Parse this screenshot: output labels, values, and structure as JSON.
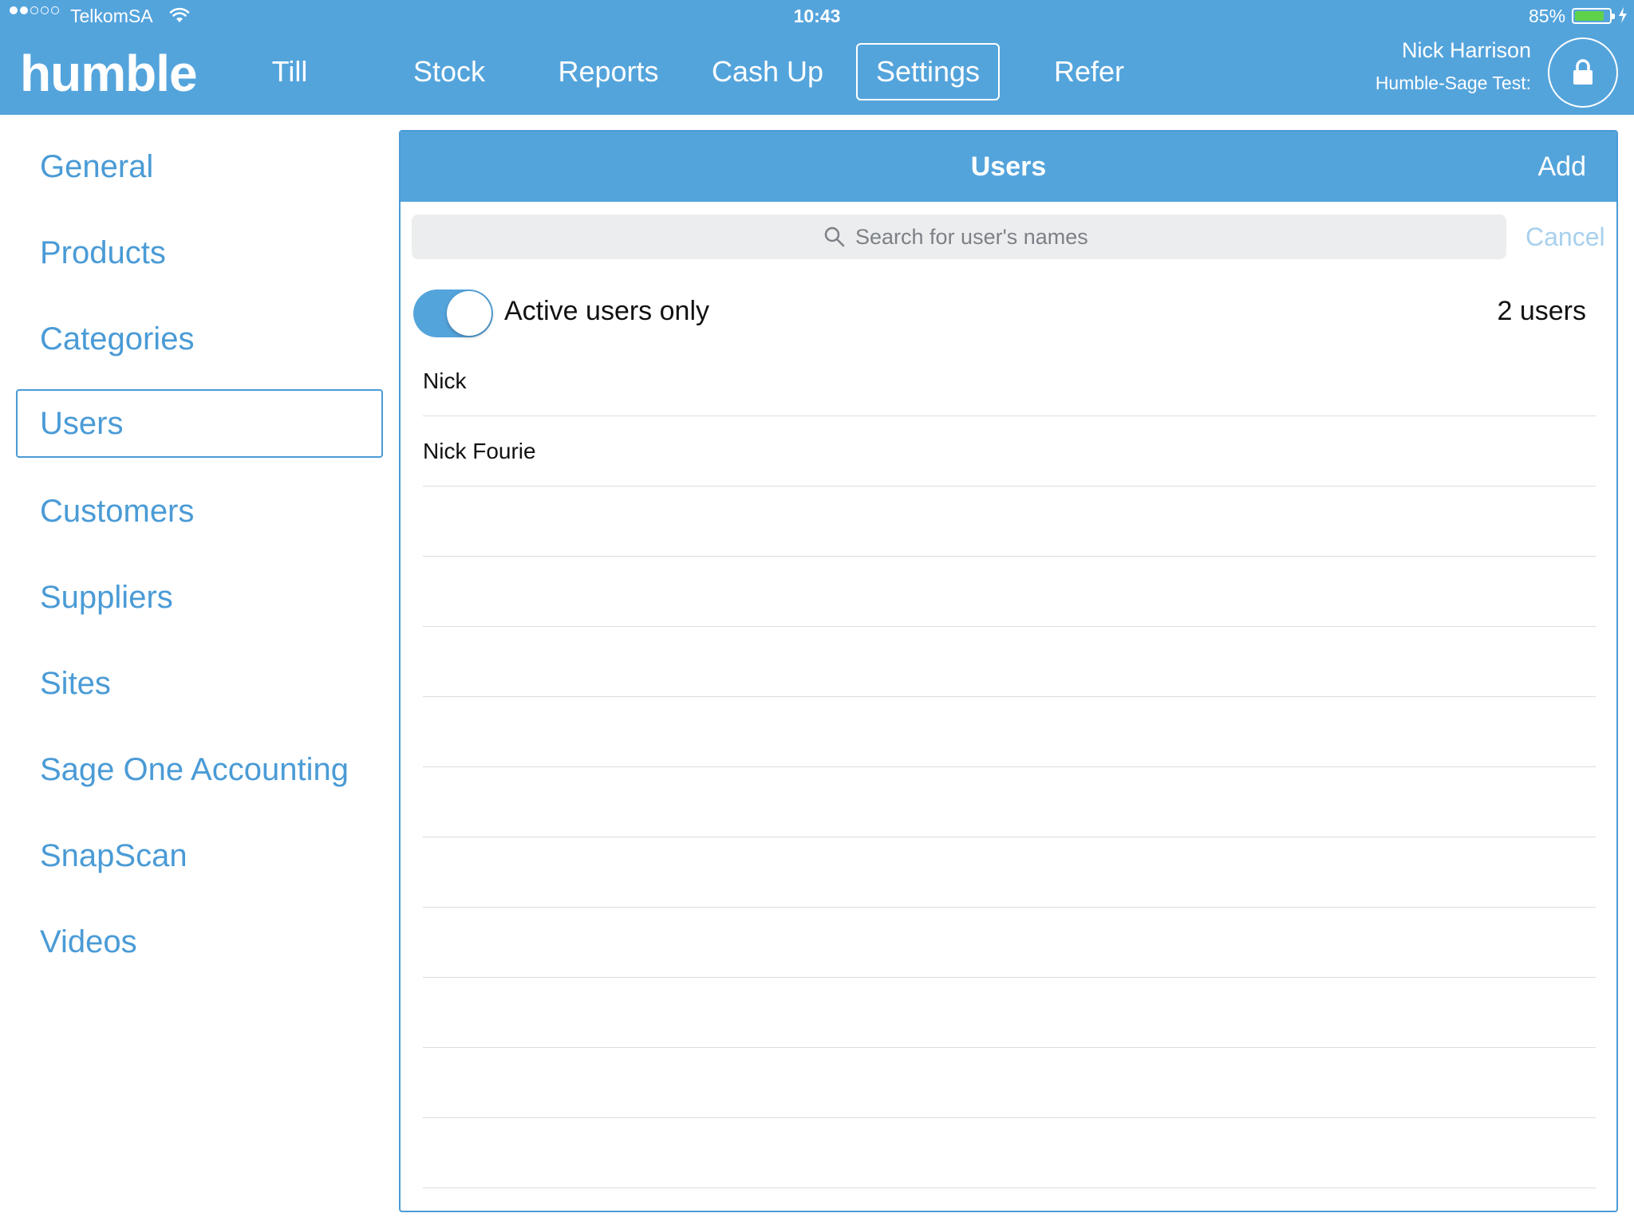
{
  "status_bar": {
    "carrier": "TelkomSA",
    "time": "10:43",
    "battery_percent": "85%",
    "battery_level": 0.85,
    "signal_bars_filled": 2,
    "signal_bars_total": 5
  },
  "app": {
    "logo": "humble",
    "nav": [
      {
        "label": "Till"
      },
      {
        "label": "Stock"
      },
      {
        "label": "Reports"
      },
      {
        "label": "Cash Up"
      },
      {
        "label": "Settings",
        "active": true
      },
      {
        "label": "Refer"
      }
    ],
    "user_name": "Nick Harrison",
    "site_name": "Humble-Sage Test:",
    "lock_icon": "lock-icon"
  },
  "sidebar": {
    "items": [
      {
        "label": "General"
      },
      {
        "label": "Products"
      },
      {
        "label": "Categories"
      },
      {
        "label": "Users",
        "active": true
      },
      {
        "label": "Customers"
      },
      {
        "label": "Suppliers"
      },
      {
        "label": "Sites"
      },
      {
        "label": "Sage One Accounting"
      },
      {
        "label": "SnapScan"
      },
      {
        "label": "Videos"
      }
    ]
  },
  "users_panel": {
    "title": "Users",
    "add_label": "Add",
    "search": {
      "placeholder": "Search for user's names",
      "value": "",
      "cancel_label": "Cancel"
    },
    "filter": {
      "label": "Active users only",
      "enabled": true
    },
    "count_label": "2 users",
    "users": [
      {
        "name": "Nick"
      },
      {
        "name": "Nick Fourie"
      },
      {
        "name": ""
      },
      {
        "name": ""
      },
      {
        "name": ""
      },
      {
        "name": ""
      },
      {
        "name": ""
      },
      {
        "name": ""
      },
      {
        "name": ""
      },
      {
        "name": ""
      },
      {
        "name": ""
      },
      {
        "name": ""
      },
      {
        "name": ""
      }
    ]
  },
  "colors": {
    "brand_blue": "#54a4dc",
    "link_blue": "#4a9bd6",
    "battery_green": "#5fd24a",
    "cancel_disabled": "#a8d0ee"
  }
}
